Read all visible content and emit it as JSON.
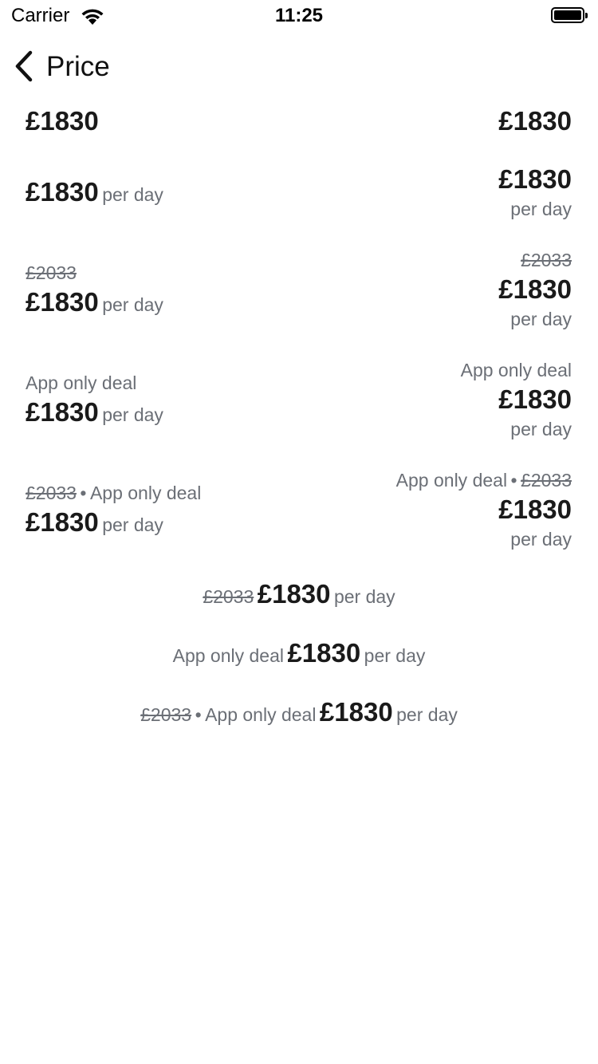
{
  "status": {
    "carrier": "Carrier",
    "time": "11:25"
  },
  "nav": {
    "title": "Price",
    "back_icon": "chevron-left-icon"
  },
  "prices": {
    "old": "£2033",
    "current": "£1830",
    "unit": "per day",
    "deal": "App only deal",
    "separator": "•"
  }
}
